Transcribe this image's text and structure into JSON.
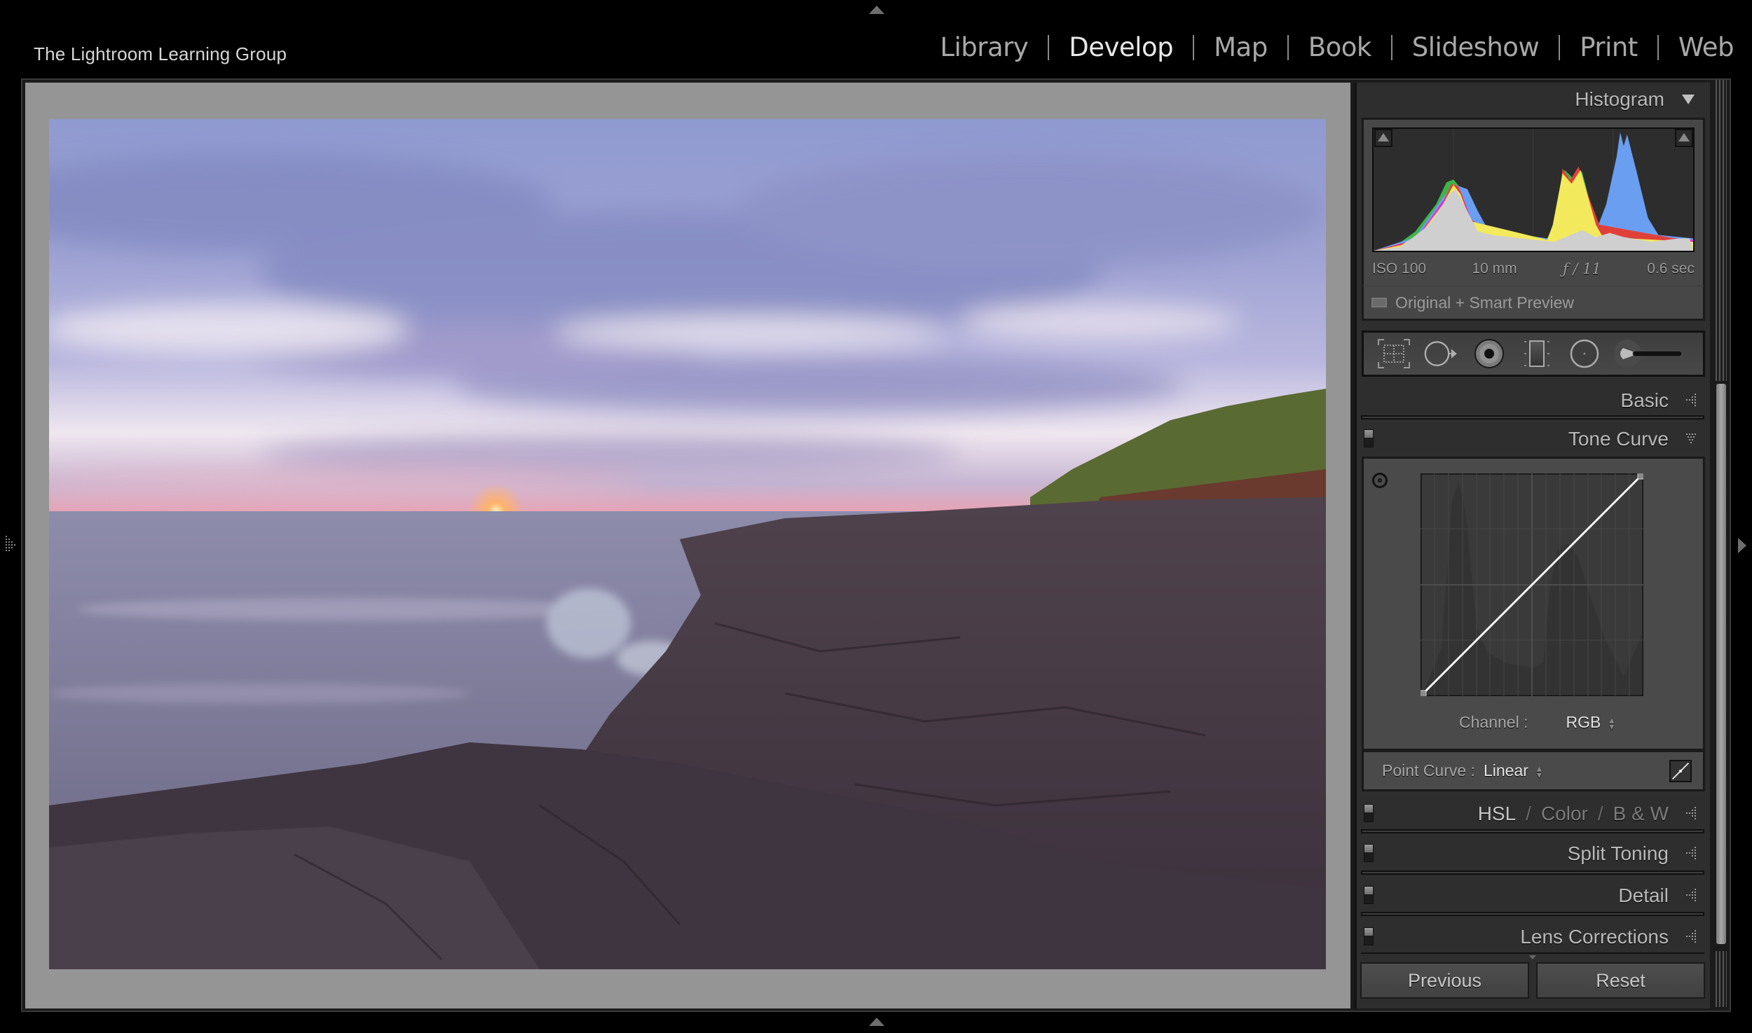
{
  "app": {
    "identity_plate": "The Lightroom Learning Group"
  },
  "modules": [
    {
      "label": "Library",
      "active": false
    },
    {
      "label": "Develop",
      "active": true
    },
    {
      "label": "Map",
      "active": false
    },
    {
      "label": "Book",
      "active": false
    },
    {
      "label": "Slideshow",
      "active": false
    },
    {
      "label": "Print",
      "active": false
    },
    {
      "label": "Web",
      "active": false
    }
  ],
  "photo": {
    "description": "Sunset over lake with purple clouds and rocky shoreline",
    "colors": {
      "sky_top": "#8e97c8",
      "sky_mid": "#a3a6d2",
      "sky_glow": "#f1e6ee",
      "horizon_pink": "#e8a6b8",
      "sun": "#ffcf70",
      "water": "#7c7996",
      "rock": "#4a3f4b",
      "rock_dark": "#362d38",
      "trees": "#5e6b35"
    }
  },
  "histogram": {
    "title": "Histogram",
    "exif": {
      "iso": "ISO 100",
      "focal_length": "10 mm",
      "aperture": "ƒ / 11",
      "shutter": "0.6 sec"
    },
    "preview_status": "Original + Smart Preview",
    "colors": {
      "luminance": "#c8c8c8",
      "red": "#e0403a",
      "green": "#3fb34a",
      "blue": "#6a9ef0",
      "yellow": "#f2ea5c",
      "magenta": "#e42ad0",
      "cyan": "#35c6d4"
    }
  },
  "tools": [
    {
      "name": "crop-overlay-icon"
    },
    {
      "name": "spot-removal-icon"
    },
    {
      "name": "red-eye-correction-icon"
    },
    {
      "name": "graduated-filter-icon"
    },
    {
      "name": "radial-filter-icon"
    },
    {
      "name": "adjustment-brush-icon"
    }
  ],
  "panels": {
    "basic": {
      "label": "Basic"
    },
    "tone_curve": {
      "label": "Tone Curve",
      "channel_label": "Channel :",
      "channel_value": "RGB",
      "point_curve_label": "Point Curve :",
      "point_curve_value": "Linear",
      "curve_points": [
        [
          0,
          0
        ],
        [
          1,
          1
        ]
      ]
    },
    "hsl": {
      "parts": [
        "HSL",
        "Color",
        "B & W"
      ],
      "separator": "/"
    },
    "split_toning": {
      "label": "Split Toning"
    },
    "detail": {
      "label": "Detail"
    },
    "lens_corrections": {
      "label": "Lens Corrections"
    }
  },
  "buttons": {
    "previous": "Previous",
    "reset": "Reset"
  }
}
